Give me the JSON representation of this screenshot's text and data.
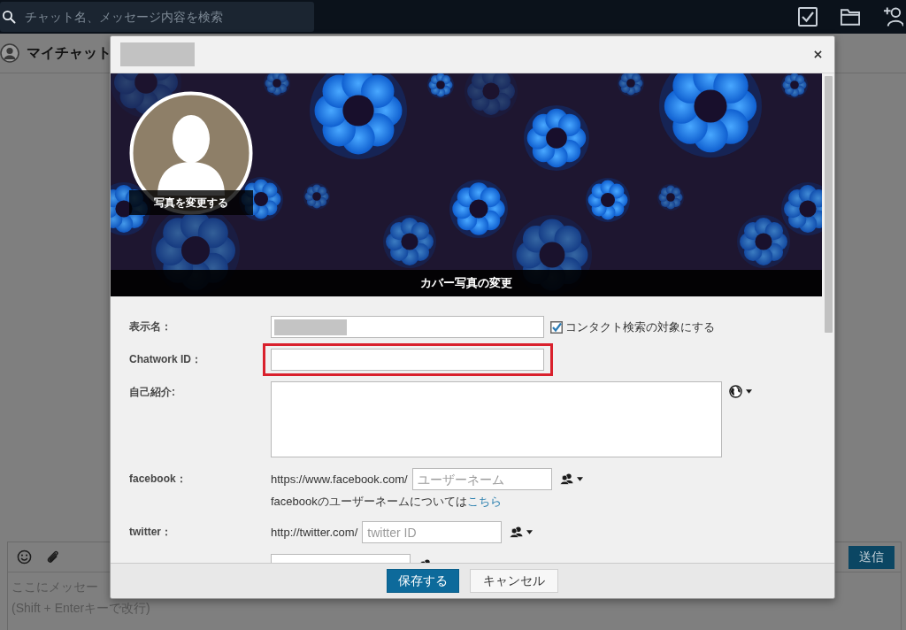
{
  "top_bar": {
    "search": {
      "placeholder": "チャット名、メッセージ内容を検索"
    }
  },
  "chat_header": {
    "title": "マイチャット"
  },
  "composer": {
    "send_button": "送信",
    "placeholder_lines": [
      "ここにメッセー",
      "(Shift + Enterキーで改行)"
    ]
  },
  "dialog": {
    "title_redacted": true,
    "cover": {
      "change_photo": "写真を変更する",
      "change_cover": "カバー写真の変更"
    },
    "fields": [
      {
        "kind": "text",
        "label": "表示名：",
        "value_redacted": true,
        "checkbox": {
          "label": "コンタクト検索の対象にする",
          "checked": true
        }
      },
      {
        "kind": "text",
        "label": "Chatwork ID：",
        "highlighted": true
      },
      {
        "kind": "textarea",
        "label": "自己紹介:",
        "public": true
      },
      {
        "kind": "url",
        "label": "facebook：",
        "prefix": "https://www.facebook.com/",
        "placeholder": "ユーザーネーム",
        "public": false,
        "note": "facebookのユーザーネームについては",
        "note_link": "こちら"
      },
      {
        "kind": "url",
        "label": "twitter：",
        "prefix": "http://twitter.com/",
        "placeholder": "twitter ID",
        "public": false
      },
      {
        "kind": "url",
        "public": false
      }
    ],
    "buttons": [
      {
        "kind": "primary",
        "label": "保存する"
      },
      {
        "kind": "secondary",
        "label": "キャンセル"
      }
    ]
  }
}
